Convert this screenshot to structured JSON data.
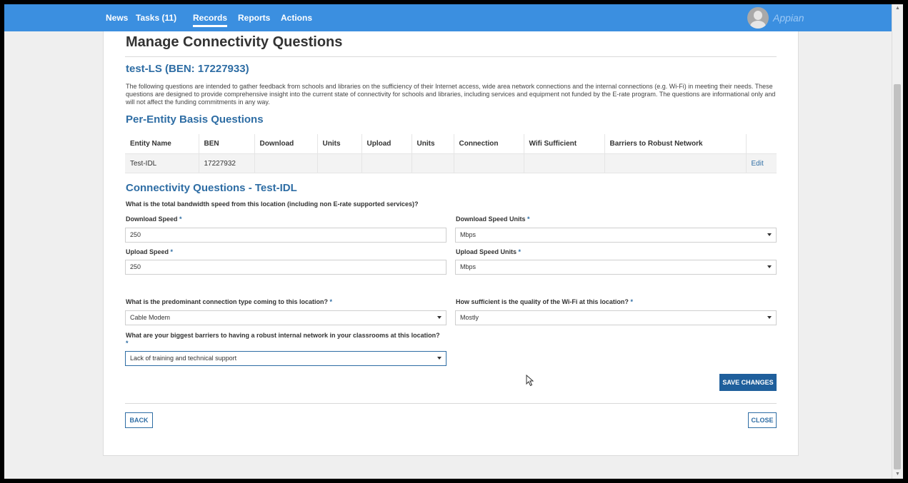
{
  "nav": {
    "items": [
      {
        "label": "News"
      },
      {
        "label": "Tasks (11)"
      },
      {
        "label": "Records"
      },
      {
        "label": "Reports"
      },
      {
        "label": "Actions"
      }
    ],
    "active": "Records",
    "brand": "Appian"
  },
  "page": {
    "title": "Manage Connectivity Questions",
    "entity_title": "test-LS (BEN: 17227933)",
    "intro": "The following questions are intended to gather feedback from schools and libraries on the sufficiency of their Internet access, wide area network connections and the internal connections (e.g. Wi-Fi) in meeting their needs. These questions are designed to provide comprehensive insight into the current state of connectivity for schools and libraries, including services and equipment not funded by the E-rate program. The questions are informational only and will not affect the funding commitments in any way."
  },
  "per_entity": {
    "title": "Per-Entity Basis Questions",
    "columns": [
      "Entity Name",
      "BEN",
      "Download",
      "Units",
      "Upload",
      "Units",
      "Connection",
      "Wifi Sufficient",
      "Barriers to Robust Network",
      ""
    ],
    "rows": [
      {
        "entity_name": "Test-IDL",
        "ben": "17227932",
        "download": "",
        "units1": "",
        "upload": "",
        "units2": "",
        "connection": "",
        "wifi": "",
        "barriers": "",
        "action": "Edit"
      }
    ]
  },
  "connectivity": {
    "title": "Connectivity Questions - Test-IDL",
    "bandwidth_question": "What is the total bandwidth speed from this location (including non E-rate supported services)?",
    "required_marker": "*",
    "download_speed": {
      "label": "Download Speed",
      "value": "250"
    },
    "download_units": {
      "label": "Download Speed Units",
      "value": "Mbps"
    },
    "upload_speed": {
      "label": "Upload Speed",
      "value": "250"
    },
    "upload_units": {
      "label": "Upload Speed Units",
      "value": "Mbps"
    },
    "connection_type": {
      "label": "What is the predominant connection type coming to this location?",
      "value": "Cable Modem"
    },
    "wifi_quality": {
      "label": "How sufficient is the quality of the Wi-Fi at this location?",
      "value": "Mostly"
    },
    "barriers": {
      "label": "What are your biggest barriers to having a robust internal network in your classrooms at this location?",
      "value": "Lack of training and technical support"
    }
  },
  "buttons": {
    "save": "SAVE CHANGES",
    "back": "BACK",
    "close": "CLOSE"
  },
  "colors": {
    "nav_bg": "#3b8fe0",
    "accent": "#2e6da4",
    "primary_button": "#1f5f9c"
  }
}
